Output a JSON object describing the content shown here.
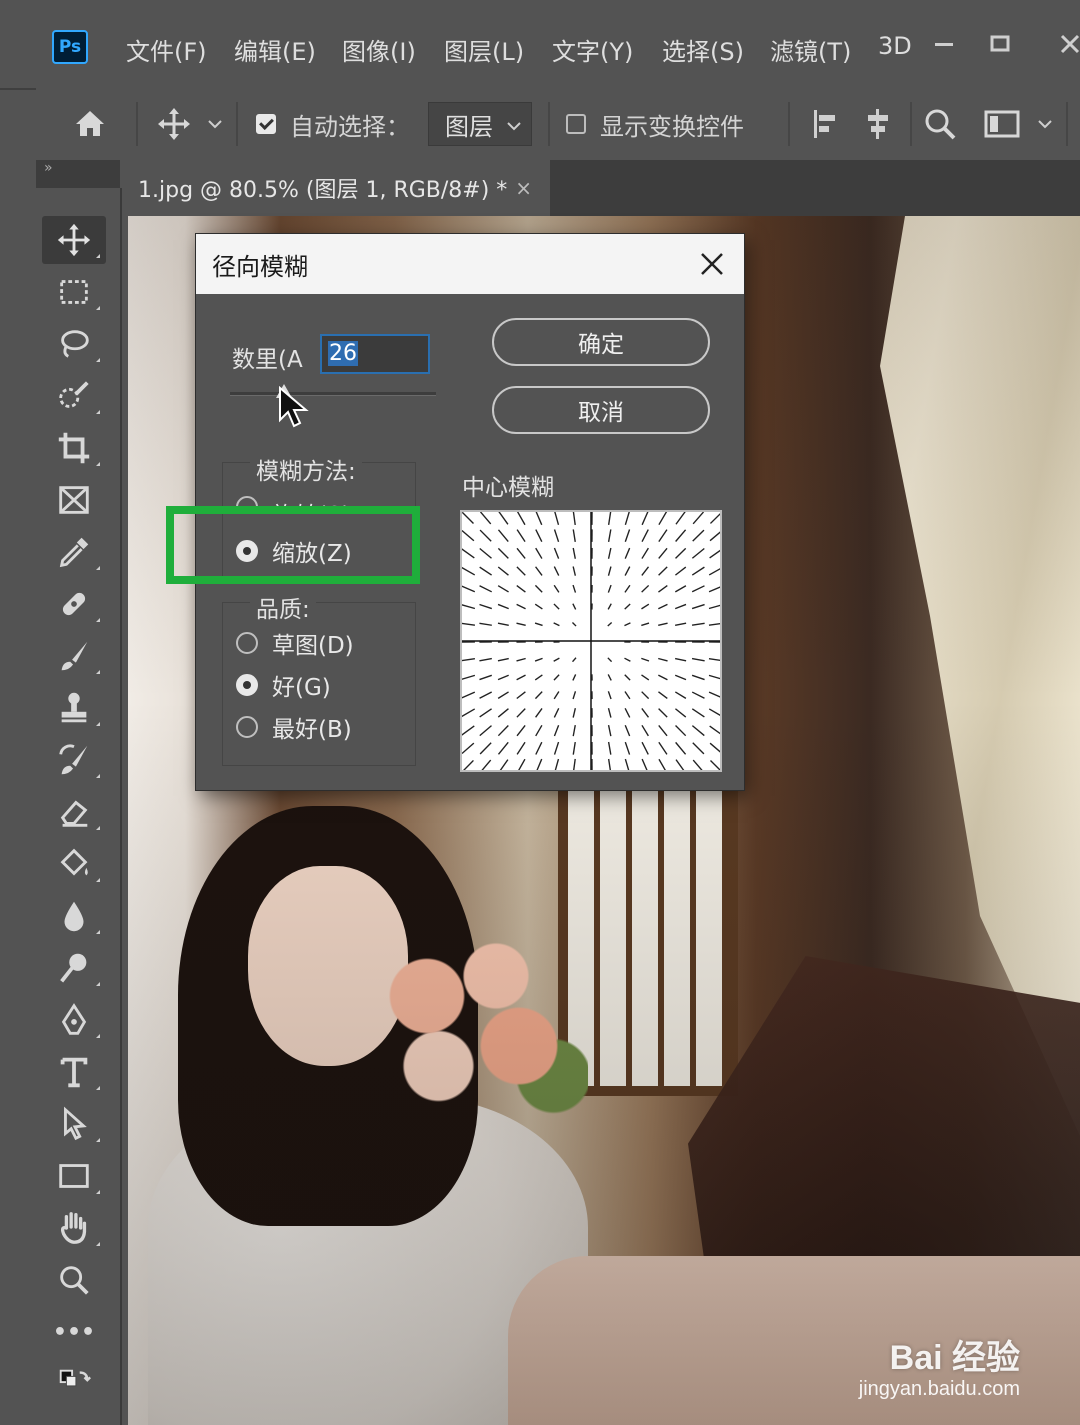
{
  "app": {
    "logo_text": "Ps",
    "menu": [
      "文件(F)",
      "编辑(E)",
      "图像(I)",
      "图层(L)",
      "文字(Y)",
      "选择(S)",
      "滤镜(T)",
      "3D"
    ],
    "window_controls": [
      "minimize-icon",
      "maximize-icon",
      "close-icon"
    ]
  },
  "options_bar": {
    "auto_select_label": "自动选择：",
    "auto_select_checked": true,
    "layer_select_value": "图层",
    "show_transform_label": "显示变换控件",
    "show_transform_checked": false,
    "icons": [
      "home-icon",
      "move-icon",
      "align-left-icon",
      "align-center-icon",
      "search-icon",
      "workspace-icon"
    ]
  },
  "document_tab": {
    "title": "1.jpg @ 80.5% (图层 1, RGB/8#) *",
    "close": "×"
  },
  "toolbar": {
    "header": "»",
    "tools": [
      "move-tool-icon",
      "marquee-tool-icon",
      "lasso-tool-icon",
      "quick-select-tool-icon",
      "crop-tool-icon",
      "frame-tool-icon",
      "eyedropper-tool-icon",
      "healing-brush-tool-icon",
      "brush-tool-icon",
      "clone-stamp-tool-icon",
      "history-brush-tool-icon",
      "eraser-tool-icon",
      "paint-bucket-tool-icon",
      "blur-tool-icon",
      "dodge-tool-icon",
      "pen-tool-icon",
      "type-tool-icon",
      "path-select-tool-icon",
      "rectangle-tool-icon",
      "hand-tool-icon",
      "zoom-tool-icon",
      "more-tools-icon"
    ],
    "more_label": "•••"
  },
  "dialog": {
    "title": "径向模糊",
    "amount_label": "数里(A",
    "amount_value": "26",
    "ok_label": "确定",
    "cancel_label": "取消",
    "method_title": "模糊方法:",
    "method_options": [
      "旋转(S)",
      "缩放(Z)"
    ],
    "method_selected": "缩放(Z)",
    "quality_title": "品质:",
    "quality_options": [
      "草图(D)",
      "好(G)",
      "最好(B)"
    ],
    "quality_selected": "好(G)",
    "center_label": "中心模糊"
  },
  "watermark": {
    "brand": "Bai 经验",
    "url": "jingyan.baidu.com"
  },
  "colors": {
    "ui_bg": "#535353",
    "highlight_box": "#1fae3b",
    "input_focus": "#2a6fb0"
  }
}
